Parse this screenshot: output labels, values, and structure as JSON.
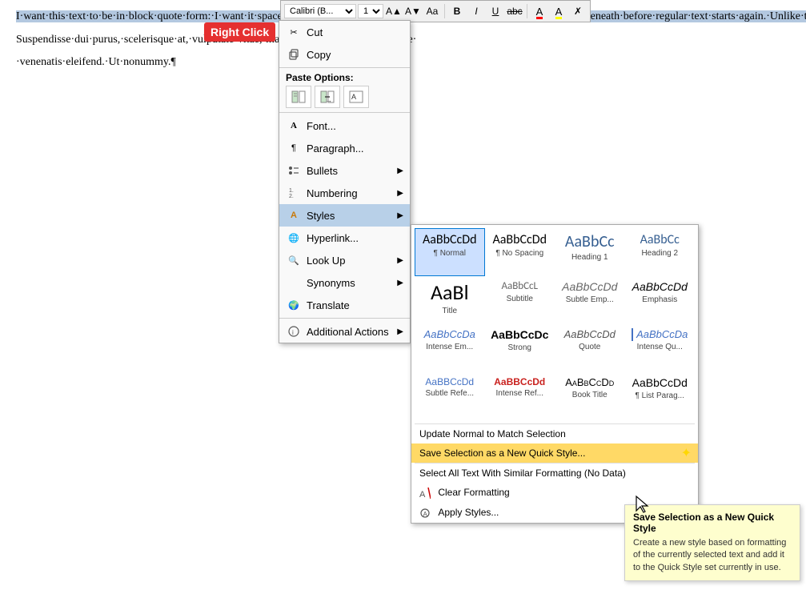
{
  "document": {
    "paragraphs": [
      "I·want·this·text·to·be·in·block·quote·form:·I·want·it·spaced·and·indented·half·an·inch·on·both·sides·and·10·points·of·space·beneath·before·regular·text·starts·again.·Unlike·the·text·above·and·below·the·first·line·indented.·I·want·to·be·able·to·use·this·Style·to·control·formatted·text·in·this·document.¶",
      "Suspendisse·dui·purus,·scelerisque·at,·vulputate·vitae,·mattis,·nunc.·Mauris·eget·neque·",
      "·venenatis·eleifend.·Ut·nonummy.¶"
    ]
  },
  "toolbar": {
    "font_name": "Calibri (B...",
    "font_size": "11",
    "bold_label": "B",
    "italic_label": "I",
    "underline_label": "U",
    "strikethrough_label": "abc",
    "font_color_label": "A",
    "highlight_label": "A"
  },
  "right_click_label": "Right Click",
  "context_menu": {
    "items": [
      {
        "id": "cut",
        "label": "Cut",
        "icon": "scissors",
        "has_arrow": false
      },
      {
        "id": "copy",
        "label": "Copy",
        "icon": "copy",
        "has_arrow": false
      },
      {
        "id": "paste-options",
        "label": "Paste Options:",
        "icon": "",
        "is_paste": true
      },
      {
        "id": "font",
        "label": "Font...",
        "icon": "font",
        "has_arrow": false
      },
      {
        "id": "paragraph",
        "label": "Paragraph...",
        "icon": "paragraph",
        "has_arrow": false
      },
      {
        "id": "bullets",
        "label": "Bullets",
        "icon": "bullets",
        "has_arrow": true
      },
      {
        "id": "numbering",
        "label": "Numbering",
        "icon": "numbering",
        "has_arrow": true
      },
      {
        "id": "styles",
        "label": "Styles",
        "icon": "styles",
        "has_arrow": true,
        "active": true
      },
      {
        "id": "hyperlink",
        "label": "Hyperlink...",
        "icon": "hyperlink",
        "has_arrow": false
      },
      {
        "id": "look-up",
        "label": "Look Up",
        "icon": "lookup",
        "has_arrow": true
      },
      {
        "id": "synonyms",
        "label": "Synonyms",
        "icon": "synonyms",
        "has_arrow": true
      },
      {
        "id": "translate",
        "label": "Translate",
        "icon": "translate",
        "has_arrow": false
      },
      {
        "id": "additional-actions",
        "label": "Additional Actions",
        "icon": "additional",
        "has_arrow": true
      }
    ],
    "paste_icons": [
      "keep_source",
      "merge",
      "text_only"
    ]
  },
  "styles_submenu": {
    "styles": [
      {
        "id": "normal",
        "preview_class": "preview-normal",
        "preview_text": "AaBbCcDd",
        "name": "¶ Normal",
        "selected": true
      },
      {
        "id": "no-spacing",
        "preview_class": "preview-nospacing",
        "preview_text": "AaBbCcDd",
        "name": "¶ No Spacing"
      },
      {
        "id": "heading1",
        "preview_class": "preview-h1",
        "preview_text": "AaBbCc",
        "name": "Heading 1"
      },
      {
        "id": "heading2",
        "preview_class": "preview-h2",
        "preview_text": "AaBbCc",
        "name": "Heading 2"
      },
      {
        "id": "title",
        "preview_class": "preview-title",
        "preview_text": "AaBl",
        "name": "Title"
      },
      {
        "id": "subtitle",
        "preview_class": "preview-subtitle",
        "preview_text": "AaBbCcL",
        "name": "Subtitle"
      },
      {
        "id": "subtle-emphasis",
        "preview_class": "preview-subtle-emp",
        "preview_text": "AaBbCcDd",
        "name": "Subtle Emp..."
      },
      {
        "id": "emphasis",
        "preview_class": "preview-emphasis",
        "preview_text": "AaBbCcDd",
        "name": "Emphasis"
      },
      {
        "id": "intense-em",
        "preview_class": "preview-intense-em",
        "preview_text": "AaBbCcDa",
        "name": "Intense Em..."
      },
      {
        "id": "strong",
        "preview_class": "preview-strong",
        "preview_text": "AaBbCcDc",
        "name": "Strong"
      },
      {
        "id": "quote",
        "preview_class": "preview-quote",
        "preview_text": "AaBbCcDd",
        "name": "Quote"
      },
      {
        "id": "intense-q",
        "preview_class": "preview-intense-q",
        "preview_text": "AaBbCcDa",
        "name": "Intense Qu..."
      },
      {
        "id": "subtle-ref",
        "preview_class": "preview-subtle-ref",
        "preview_text": "AaBBCcDd",
        "name": "Subtle Refe..."
      },
      {
        "id": "intense-ref",
        "preview_class": "preview-intense-ref",
        "preview_text": "AaBBCcDd",
        "name": "Intense Ref..."
      },
      {
        "id": "book-title",
        "preview_class": "preview-book-title",
        "preview_text": "AaBbCcDd",
        "name": "Book Title"
      },
      {
        "id": "list-para",
        "preview_class": "preview-list-para",
        "preview_text": "AaBbCcDd",
        "name": "¶ List Parag..."
      }
    ],
    "actions": [
      {
        "id": "update-normal",
        "label": "Update Normal to Match Selection"
      },
      {
        "id": "save-selection",
        "label": "Save Selection as a New Quick Style...",
        "highlighted": true
      },
      {
        "id": "select-all",
        "label": "Select All Text With Similar Formatting (No Data)"
      },
      {
        "id": "clear-formatting",
        "label": "Clear Formatting"
      },
      {
        "id": "apply-styles",
        "label": "Apply Styles..."
      }
    ]
  },
  "tooltip": {
    "title": "Save Selection as a New Quick Style",
    "text": "Create a new style based on formatting of the currently selected text and add it to the Quick Style set currently in use."
  }
}
